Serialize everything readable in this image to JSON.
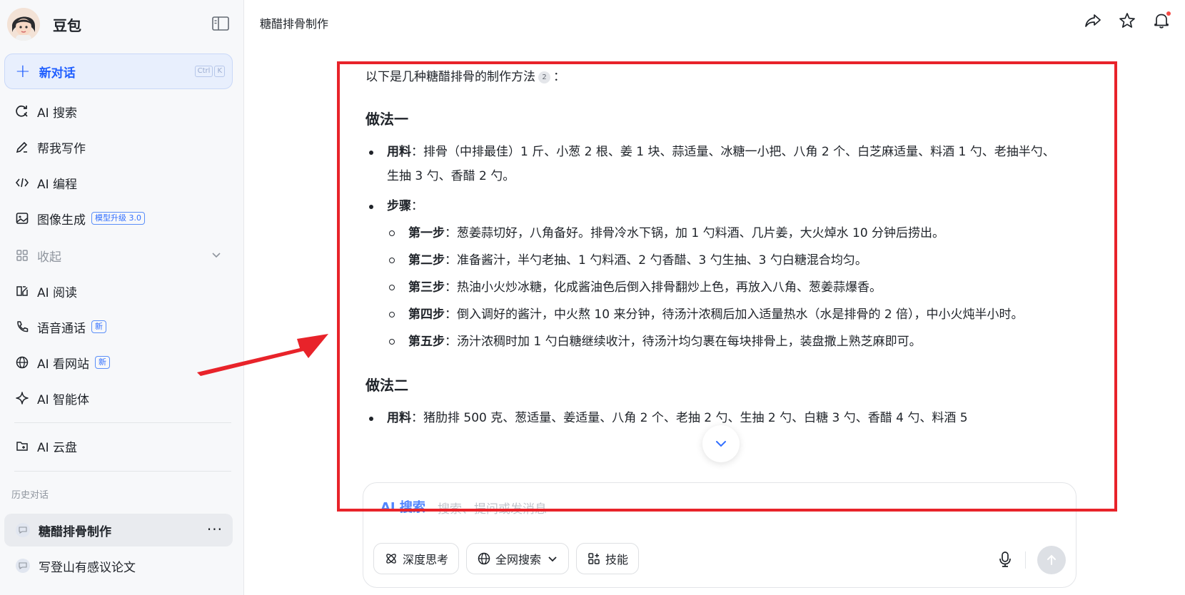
{
  "sidebar": {
    "brand_name": "豆包",
    "new_chat": {
      "label": "新对话",
      "shortcut": [
        "Ctrl",
        "K"
      ]
    },
    "items": [
      {
        "label": "AI 搜索",
        "icon": "search-refresh-icon"
      },
      {
        "label": "帮我写作",
        "icon": "pen-icon"
      },
      {
        "label": "AI 编程",
        "icon": "code-icon"
      },
      {
        "label": "图像生成",
        "icon": "image-icon",
        "badge": "模型升级 3.0"
      },
      {
        "label": "收起",
        "icon": "grid-icon"
      },
      {
        "label": "AI 阅读",
        "icon": "read-icon"
      },
      {
        "label": "语音通话",
        "icon": "phone-icon",
        "badge": "新"
      },
      {
        "label": "AI 看网站",
        "icon": "globe-icon",
        "badge": "新"
      },
      {
        "label": "AI 智能体",
        "icon": "sparkle-icon"
      },
      {
        "label": "AI 云盘",
        "icon": "cloud-drive-icon"
      }
    ],
    "history_title": "历史对话",
    "history": [
      {
        "label": "糖醋排骨制作"
      },
      {
        "label": "写登山有感议论文"
      }
    ]
  },
  "header": {
    "title": "糖醋排骨制作"
  },
  "answer": {
    "intro": "以下是几种糖醋排骨的制作方法",
    "intro_cite": "2",
    "intro_tail": "：",
    "method1": {
      "title": "做法一",
      "ingredients_key": "用料",
      "ingredients": "：排骨（中排最佳）1 斤、小葱 2 根、姜 1 块、蒜适量、冰糖一小把、八角 2 个、白芝麻适量、料酒 1 勺、老抽半勺、生抽 3 勺、香醋 2 勺。",
      "steps_key": "步骤",
      "steps_colon": "：",
      "steps": [
        {
          "key": "第一步",
          "text": "：葱姜蒜切好，八角备好。排骨冷水下锅，加 1 勺料酒、几片姜，大火焯水 10 分钟后捞出。"
        },
        {
          "key": "第二步",
          "text": "：准备酱汁，半勺老抽、1 勺料酒、2 勺香醋、3 勺生抽、3 勺白糖混合均匀。"
        },
        {
          "key": "第三步",
          "text": "：热油小火炒冰糖，化成酱油色后倒入排骨翻炒上色，再放入八角、葱姜蒜爆香。"
        },
        {
          "key": "第四步",
          "text": "：倒入调好的酱汁，中火熬 10 来分钟，待汤汁浓稠后加入适量热水（水是排骨的 2 倍），中小火炖半小时。"
        },
        {
          "key": "第五步",
          "text": "：汤汁浓稠时加 1 勺白糖继续收汁，待汤汁均匀裹在每块排骨上，装盘撒上熟芝麻即可。"
        }
      ]
    },
    "method2": {
      "title": "做法二",
      "ingredients_key": "用料",
      "ingredients": "：猪肋排 500 克、葱适量、姜适量、八角 2 个、老抽 2 勺、生抽 2 勺、白糖 3 勺、香醋 4 勺、料酒 5"
    }
  },
  "composer": {
    "mode": "AI 搜索",
    "placeholder": "搜索、提问或发消息",
    "tools": [
      {
        "label": "深度思考",
        "icon": "atom-icon"
      },
      {
        "label": "全网搜索",
        "icon": "globe-icon"
      },
      {
        "label": "技能",
        "icon": "grid-plus-icon"
      }
    ]
  },
  "colors": {
    "accent": "#3370ff",
    "annotation": "#e8232a"
  }
}
